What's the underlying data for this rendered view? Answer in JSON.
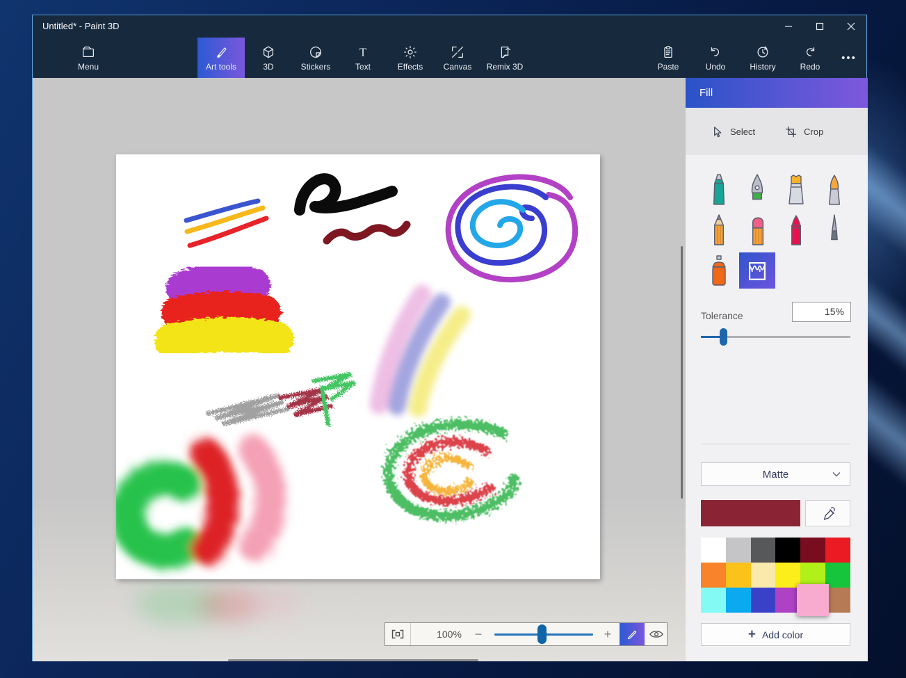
{
  "window": {
    "title": "Untitled* - Paint 3D",
    "controls": [
      "minimize",
      "maximize",
      "close"
    ]
  },
  "toolbar": {
    "menu_label": "Menu",
    "tools": [
      {
        "label": "Art tools",
        "icon": "brush-icon",
        "selected": true
      },
      {
        "label": "3D",
        "icon": "cube-icon",
        "selected": false
      },
      {
        "label": "Stickers",
        "icon": "sticker-icon",
        "selected": false
      },
      {
        "label": "Text",
        "icon": "text-icon",
        "selected": false
      },
      {
        "label": "Effects",
        "icon": "effects-sun-icon",
        "selected": false
      },
      {
        "label": "Canvas",
        "icon": "canvas-expand-icon",
        "selected": false
      },
      {
        "label": "Remix 3D",
        "icon": "remix-3d-icon",
        "selected": false
      }
    ],
    "actions": [
      {
        "label": "Paste",
        "icon": "paste-icon"
      },
      {
        "label": "Undo",
        "icon": "undo-icon"
      },
      {
        "label": "History",
        "icon": "history-icon"
      },
      {
        "label": "Redo",
        "icon": "redo-icon"
      }
    ],
    "more_label": "•••"
  },
  "panel": {
    "title": "Fill",
    "select_label": "Select",
    "crop_label": "Crop",
    "brushes": [
      "marker",
      "calligraphy-pen",
      "oil-brush",
      "watercolour",
      "pencil",
      "eraser",
      "crayon",
      "pixel-pen",
      "spray-can",
      "fill"
    ],
    "selected_brush": "fill",
    "tolerance": {
      "label": "Tolerance",
      "value": "15%",
      "slider_percent": 15
    },
    "finish": {
      "value": "Matte"
    },
    "current_color": "#8a2434",
    "palette": [
      "#ffffff",
      "#c5c5c7",
      "#575859",
      "#000000",
      "#790d1f",
      "#ea1b23",
      "#f8832b",
      "#fcc21c",
      "#f9e9aa",
      "#fbee1a",
      "#b2f019",
      "#17c53c",
      "#83fbf4",
      "#0ba9f0",
      "#3a41c9",
      "#ad42c5",
      "#f8abce",
      "#b67b54"
    ],
    "selected_palette_color": "#f8abce",
    "add_color_label": "Add color"
  },
  "zoombar": {
    "zoom_value": "100%",
    "minus_label": "−",
    "plus_label": "+",
    "slider_percent": 48
  },
  "accent": {
    "gradient_start": "#2a53c8",
    "gradient_end": "#7e58dd"
  },
  "canvas": {
    "strokes": [
      {
        "name": "marker-lines",
        "colors": [
          "#3b55cf",
          "#f7b81c",
          "#e82329"
        ]
      },
      {
        "name": "black-squiggle",
        "colors": [
          "#0b0b0b",
          "#7e1722"
        ]
      },
      {
        "name": "spiral",
        "colors": [
          "#b341c5",
          "#3a3ecf",
          "#23a7e8"
        ]
      },
      {
        "name": "oil-strokes",
        "colors": [
          "#a93bd1",
          "#e8211c",
          "#f2e413"
        ]
      },
      {
        "name": "watercolour-arc",
        "colors": [
          "#eaaede",
          "#8b8fd8",
          "#f3e96b"
        ]
      },
      {
        "name": "crayon-scribble",
        "colors": [
          "#9a9a9a",
          "#9c2438",
          "#35c156"
        ]
      },
      {
        "name": "spray-blobs",
        "colors": [
          "#27c24b",
          "#dd2026",
          "#f4a0b5"
        ]
      },
      {
        "name": "spray-loop",
        "colors": [
          "#2db34a",
          "#d6202a",
          "#f5a81c"
        ]
      }
    ]
  }
}
